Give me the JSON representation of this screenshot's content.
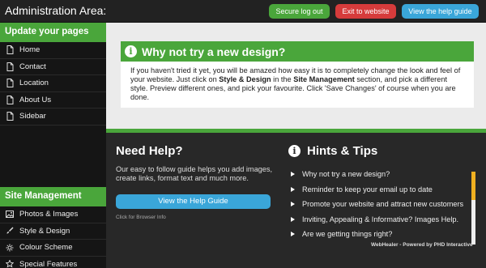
{
  "header": {
    "title": "Administration Area:",
    "buttons": {
      "logout": "Secure log out",
      "exit": "Exit to website",
      "guide": "View the help guide"
    }
  },
  "sidebar": {
    "pages_heading": "Update your pages",
    "pages": [
      "Home",
      "Contact",
      "Location",
      "About Us",
      "Sidebar"
    ],
    "management_heading": "Site Management",
    "management": [
      {
        "label": "Photos & Images",
        "icon": "image-icon"
      },
      {
        "label": "Style & Design",
        "icon": "brush-icon"
      },
      {
        "label": "Colour Scheme",
        "icon": "sun-icon"
      },
      {
        "label": "Special Features",
        "icon": "star-icon"
      }
    ]
  },
  "notice": {
    "title": "Why not try a new design?",
    "body": {
      "part1": "If you haven't tried it yet, you will be amazed how easy it is to completely change the look and feel of your website. Just click on ",
      "bold1": "Style & Design",
      "part2": " in the ",
      "bold2": "Site Management",
      "part3": " section, and pick a different style. Preview different ones, and pick your favourite. Click 'Save Changes' of course when you are done."
    }
  },
  "help": {
    "title": "Need Help?",
    "text": "Our easy to follow guide helps you add images, create links, format text and much more.",
    "button": "View the Help Guide",
    "browser_info": "Click for Browser Info"
  },
  "hints": {
    "title": "Hints & Tips",
    "items": [
      "Why not try a new design?",
      "Reminder to keep your email up to date",
      "Promote your website and attract new customers",
      "Inviting, Appealing & Informative? Images Help.",
      "Are we getting things right?"
    ]
  },
  "footer": {
    "credit": "WebHealer - Powered by PHD Interactive"
  },
  "colors": {
    "green": "#4aa63b",
    "red": "#d63b3b",
    "blue": "#3aa6d9"
  }
}
